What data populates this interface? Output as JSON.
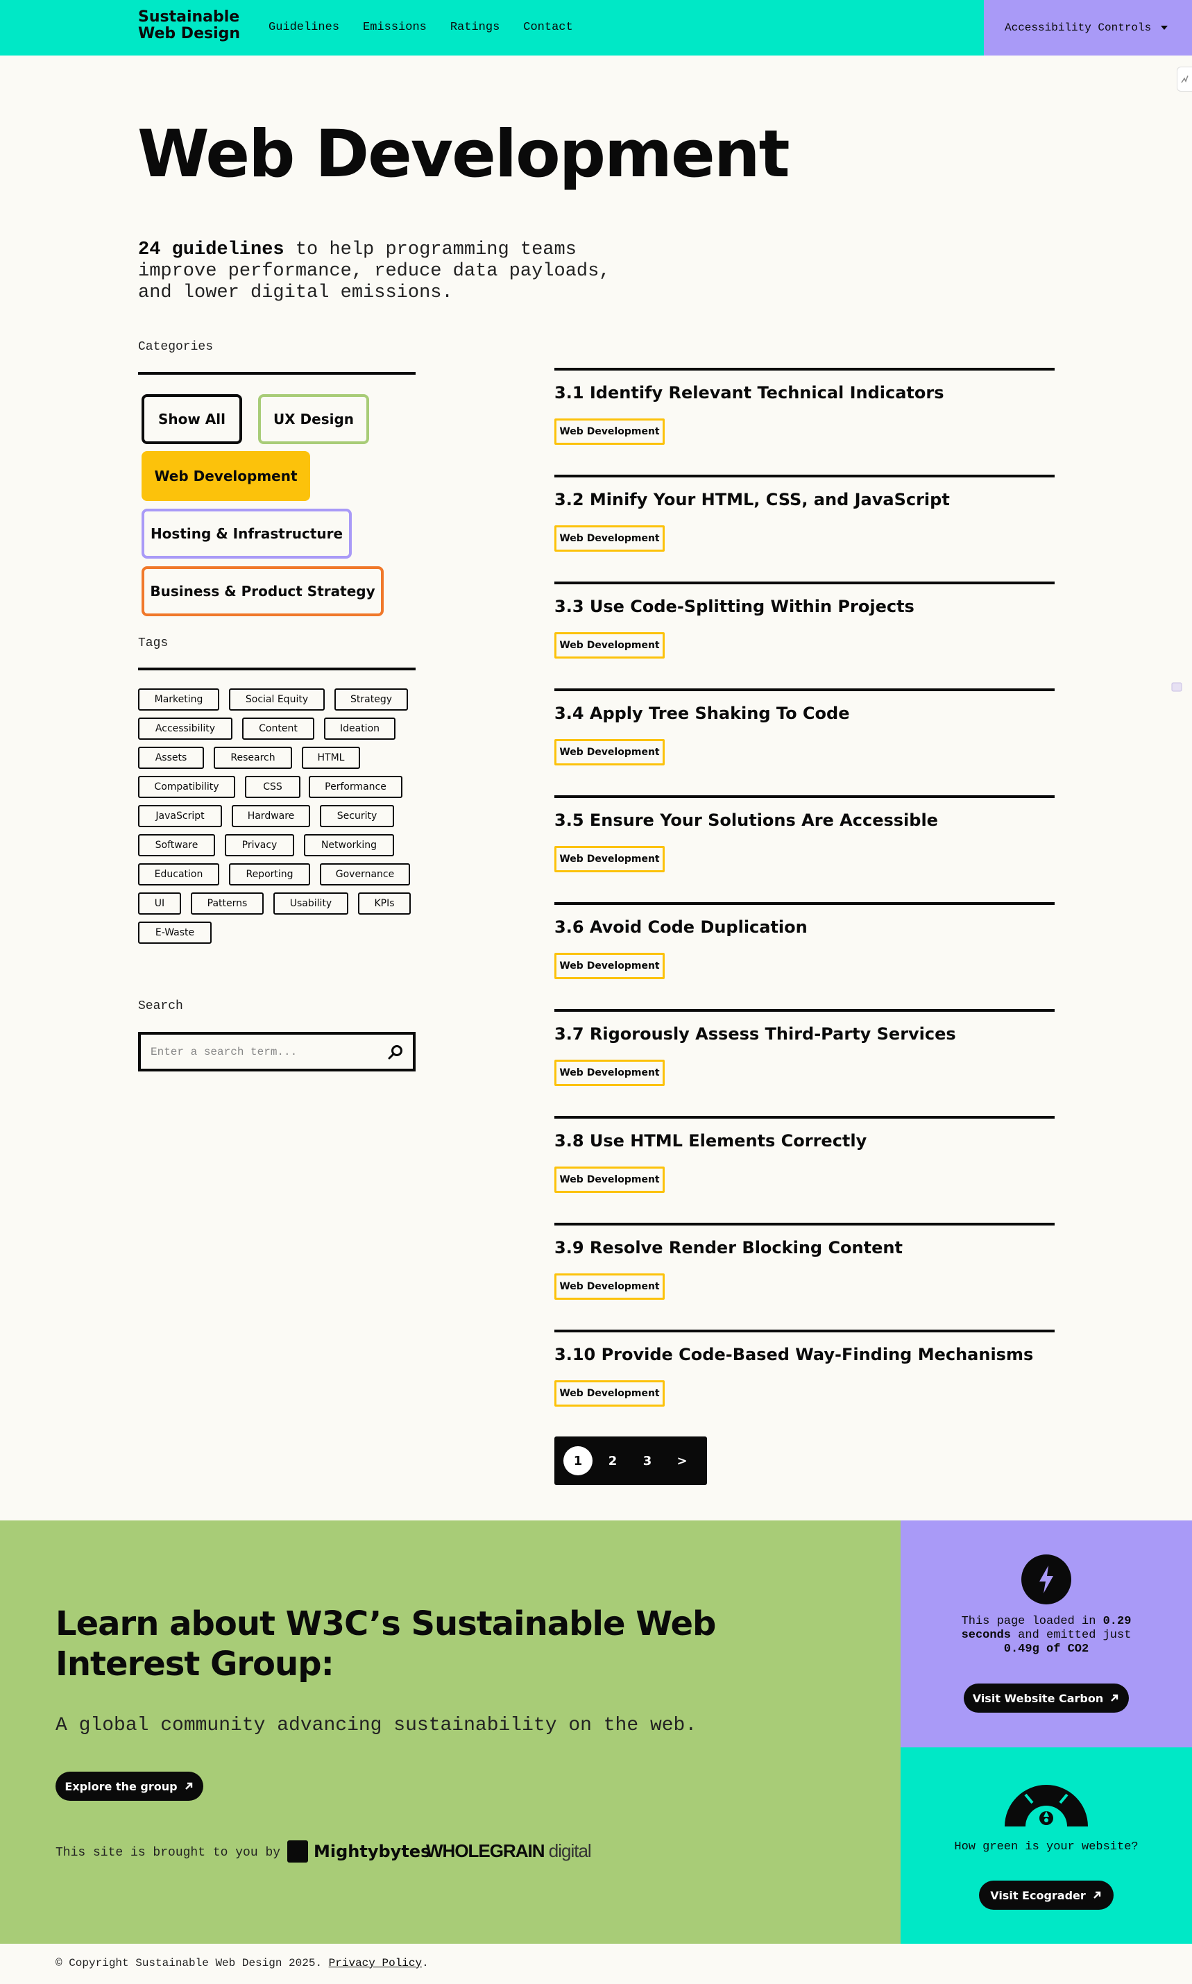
{
  "header": {
    "logo_line1": "Sustainable",
    "logo_line2": "Web Design",
    "nav": [
      "Guidelines",
      "Emissions",
      "Ratings",
      "Contact"
    ],
    "accessibility_label": "Accessibility Controls"
  },
  "page": {
    "title": "Web Development",
    "intro_bold": "24 guidelines",
    "intro_line1_rest": " to help programming teams",
    "intro_line2": "improve performance, reduce data payloads,",
    "intro_line3": "and lower digital emissions."
  },
  "categories": {
    "label": "Categories",
    "items": [
      {
        "label": "Show All",
        "border": "#0a0a0a",
        "fill": ""
      },
      {
        "label": "UX Design",
        "border": "#a8cc77",
        "fill": ""
      },
      {
        "label": "Web Development",
        "border": "#fcc20b",
        "fill": "#fcc20b"
      },
      {
        "label": "Hosting & Infrastructure",
        "border": "#a99af7",
        "fill": ""
      },
      {
        "label": "Business & Product Strategy",
        "border": "#f0782a",
        "fill": ""
      }
    ]
  },
  "tags": {
    "label": "Tags",
    "items": [
      "Marketing",
      "Social Equity",
      "Strategy",
      "Accessibility",
      "Content",
      "Ideation",
      "Assets",
      "Research",
      "HTML",
      "Compatibility",
      "CSS",
      "Performance",
      "JavaScript",
      "Hardware",
      "Security",
      "Software",
      "Privacy",
      "Networking",
      "Education",
      "Reporting",
      "Governance",
      "UI",
      "Patterns",
      "Usability",
      "KPIs",
      "E-Waste"
    ]
  },
  "search": {
    "label": "Search",
    "placeholder": "Enter a search term...",
    "value": ""
  },
  "guidelines": [
    {
      "title": "3.1 Identify Relevant Technical Indicators",
      "tag": "Web Development"
    },
    {
      "title": "3.2 Minify Your HTML, CSS, and JavaScript",
      "tag": "Web Development"
    },
    {
      "title": "3.3 Use Code-Splitting Within Projects",
      "tag": "Web Development"
    },
    {
      "title": "3.4 Apply Tree Shaking To Code",
      "tag": "Web Development"
    },
    {
      "title": "3.5 Ensure Your Solutions Are Accessible",
      "tag": "Web Development"
    },
    {
      "title": "3.6 Avoid Code Duplication",
      "tag": "Web Development"
    },
    {
      "title": "3.7 Rigorously Assess Third-Party Services",
      "tag": "Web Development"
    },
    {
      "title": "3.8 Use HTML Elements Correctly",
      "tag": "Web Development"
    },
    {
      "title": "3.9 Resolve Render Blocking Content",
      "tag": "Web Development"
    },
    {
      "title": "3.10 Provide Code-Based Way-Finding Mechanisms",
      "tag": "Web Development"
    }
  ],
  "pagination": {
    "pages": [
      "1",
      "2",
      "3"
    ],
    "next": ">",
    "current": "1"
  },
  "footer": {
    "title": "Learn about W3C’s Sustainable Web Interest Group:",
    "subtitle": "A global community advancing sustainability on the web.",
    "explore_button": "Explore the group",
    "brought_by": "This site is brought to you by",
    "mightybytes": "Mightybytes",
    "wholegrain_main": "WHOLEGRAIN",
    "wholegrain_digital": " digital",
    "carbon_line1_pre": "This page loaded in ",
    "carbon_seconds": "0.29",
    "carbon_line2_unit": "seconds",
    "carbon_line2_rest": " and emitted just",
    "carbon_co2": "0.49g of CO2",
    "carbon_button": "Visit Website Carbon",
    "eco_question": "How green is your website?",
    "eco_button": "Visit Ecograder",
    "copyright": "© Copyright Sustainable Web Design 2025.",
    "privacy": "Privacy Policy",
    "copyright_end": "."
  },
  "colors": {
    "teal": "#00e8c6",
    "purple": "#a99af7",
    "green": "#a8cc77",
    "yellow": "#fcc20b",
    "orange": "#f0782a"
  }
}
